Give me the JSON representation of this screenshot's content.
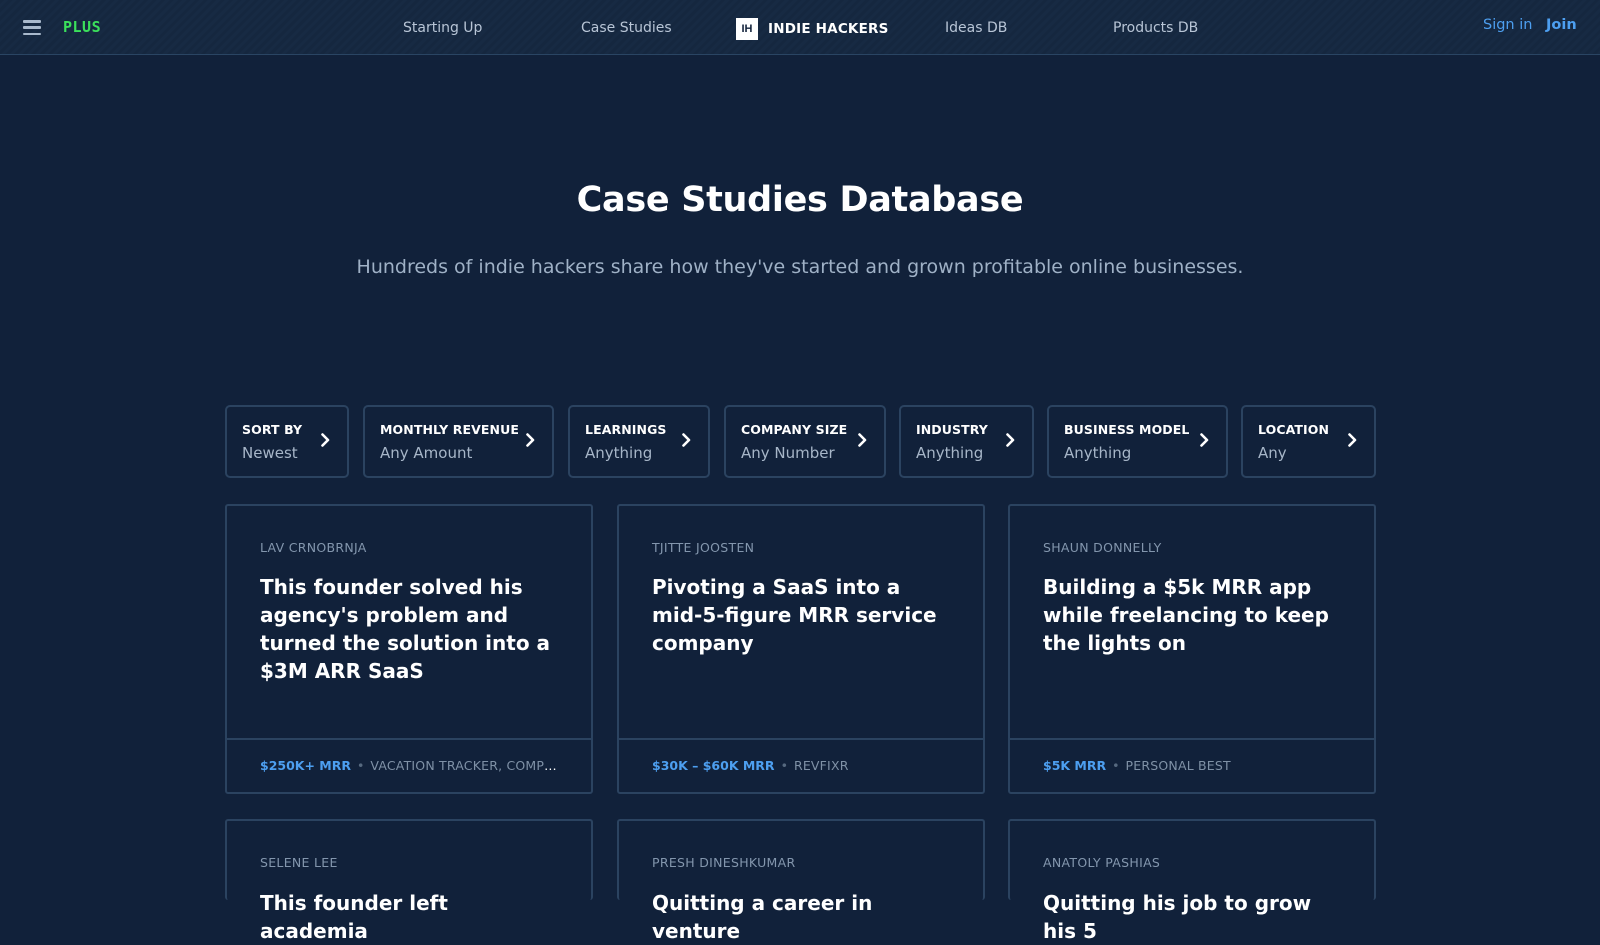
{
  "nav": {
    "plus_label": "PLUS",
    "links": [
      "Starting Up",
      "Case Studies",
      "Ideas DB",
      "Products DB"
    ],
    "brand_logo": "IH",
    "brand_name": "INDIE HACKERS",
    "sign_in": "Sign in",
    "join": "Join"
  },
  "hero": {
    "title": "Case Studies Database",
    "subtitle": "Hundreds of indie hackers share how they've started and grown profitable online businesses."
  },
  "filters": [
    {
      "label": "SORT BY",
      "value": "Newest"
    },
    {
      "label": "MONTHLY REVENUE",
      "value": "Any Amount"
    },
    {
      "label": "LEARNINGS",
      "value": "Anything"
    },
    {
      "label": "COMPANY SIZE",
      "value": "Any Number"
    },
    {
      "label": "INDUSTRY",
      "value": "Anything"
    },
    {
      "label": "BUSINESS MODEL",
      "value": "Anything"
    },
    {
      "label": "LOCATION",
      "value": "Any"
    }
  ],
  "cards": [
    {
      "author": "LAV CRNOBRNJA",
      "title": "This founder solved his agency's problem and turned the solution into a $3M ARR SaaS",
      "revenue": "$250K+ MRR",
      "tag": "VACATION TRACKER, COMPETIT..."
    },
    {
      "author": "TJITTE JOOSTEN",
      "title": "Pivoting a SaaS into a mid-5-figure MRR service company",
      "revenue": "$30K – $60K MRR",
      "tag": "REVFIXR"
    },
    {
      "author": "SHAUN DONNELLY",
      "title": "Building a $5k MRR app while freelancing to keep the lights on",
      "revenue": "$5K MRR",
      "tag": "PERSONAL BEST"
    },
    {
      "author": "SELENE LEE",
      "title": "This founder left academia",
      "revenue": "",
      "tag": ""
    },
    {
      "author": "PRESH DINESHKUMAR",
      "title": "Quitting a career in venture",
      "revenue": "",
      "tag": ""
    },
    {
      "author": "ANATOLY PASHIAS",
      "title": "Quitting his job to grow his 5",
      "revenue": "",
      "tag": ""
    }
  ],
  "colors": {
    "background": "#11213a",
    "accent": "#4d9ff0",
    "plus": "#3be05b",
    "border": "#2b4360"
  },
  "icons": {
    "menu": "hamburger-icon",
    "filter_arrow": "chevron-right-icon"
  }
}
